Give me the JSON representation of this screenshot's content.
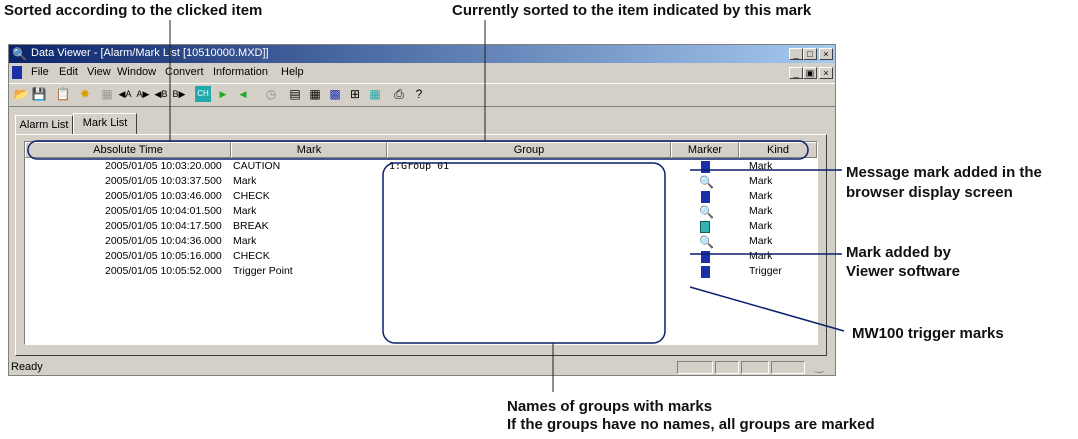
{
  "callouts": {
    "sorted_clicked": "Sorted according to the clicked item",
    "currently_sorted": "Currently sorted to the item indicated by this mark",
    "message_mark_1": "Message mark added in the",
    "message_mark_2": "browser display screen",
    "viewer_mark_1": "Mark added by",
    "viewer_mark_2": "Viewer software",
    "trigger_marks": "MW100 trigger marks",
    "group_names_1": "Names of groups with marks",
    "group_names_2": "If the groups have no names, all groups are marked"
  },
  "window": {
    "title": "Data Viewer - [Alarm/Mark List [10510000.MXD]]",
    "menu": [
      "File",
      "Edit",
      "View",
      "Window",
      "Convert",
      "Information",
      "Help"
    ],
    "tabs": [
      "Alarm List",
      "Mark List"
    ],
    "columns": [
      "Absolute Time",
      "Mark",
      "Group",
      "Marker",
      "Kind"
    ],
    "rows": [
      {
        "time": "2005/01/05 10:03:20.000",
        "mark": "CAUTION",
        "group": "1:Group 01",
        "marker": "flag",
        "kind": "Mark"
      },
      {
        "time": "2005/01/05 10:03:37.500",
        "mark": "Mark",
        "group": "",
        "marker": "magnifier",
        "kind": "Mark"
      },
      {
        "time": "2005/01/05 10:03:46.000",
        "mark": "CHECK",
        "group": "",
        "marker": "flag",
        "kind": "Mark"
      },
      {
        "time": "2005/01/05 10:04:01.500",
        "mark": "Mark",
        "group": "",
        "marker": "magnifier",
        "kind": "Mark"
      },
      {
        "time": "2005/01/05 10:04:17.500",
        "mark": "BREAK",
        "group": "",
        "marker": "calculator",
        "kind": "Mark"
      },
      {
        "time": "2005/01/05 10:04:36.000",
        "mark": "Mark",
        "group": "",
        "marker": "magnifier",
        "kind": "Mark"
      },
      {
        "time": "2005/01/05 10:05:16.000",
        "mark": "CHECK",
        "group": "",
        "marker": "flag",
        "kind": "Mark"
      },
      {
        "time": "2005/01/05 10:05:52.000",
        "mark": "Trigger Point",
        "group": "",
        "marker": "flag",
        "kind": "Trigger"
      }
    ],
    "status": "Ready"
  }
}
